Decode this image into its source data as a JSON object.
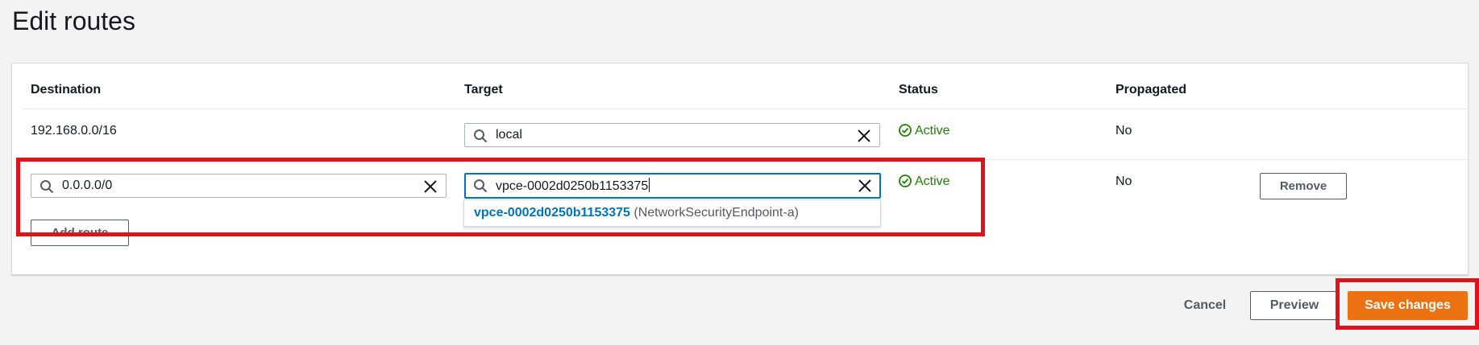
{
  "page": {
    "title": "Edit routes"
  },
  "table": {
    "columns": [
      "Destination",
      "Target",
      "Status",
      "Propagated"
    ],
    "rows": [
      {
        "destination": "192.168.0.0/16",
        "target": "local",
        "status": "Active",
        "propagated": "No"
      },
      {
        "destination": "0.0.0.0/0",
        "target": "vpce-0002d0250b1153375",
        "status": "Active",
        "propagated": "No",
        "remove_label": "Remove"
      }
    ]
  },
  "suggestion": {
    "id": "vpce-0002d0250b1153375",
    "description": "(NetworkSecurityEndpoint-a)"
  },
  "add_route_label": "Add route",
  "footer": {
    "cancel": "Cancel",
    "preview": "Preview",
    "save": "Save changes"
  },
  "colors": {
    "accent_orange": "#ec7211",
    "link_blue": "#0073bb",
    "status_green": "#1d8102",
    "highlight_red": "#e0131c"
  }
}
